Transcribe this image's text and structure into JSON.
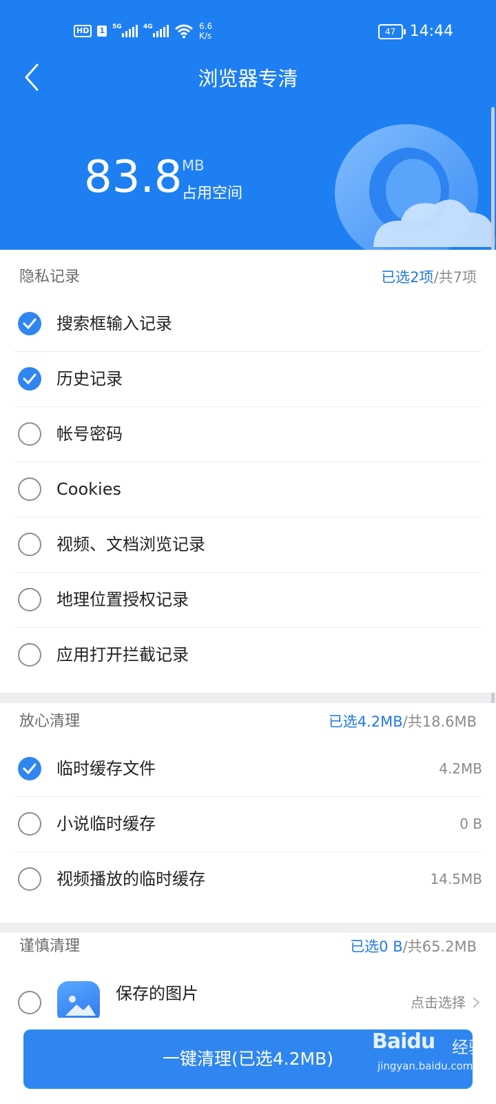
{
  "status_bar": {
    "hd_label": "HD",
    "sim_label": "1",
    "network1": "5G",
    "network2": "4G",
    "speed_value": "6.6",
    "speed_unit": "K/s",
    "battery": "47",
    "time": "14:44"
  },
  "header": {
    "title": "浏览器专清",
    "size_value": "83.8",
    "size_unit": "MB",
    "size_label": "占用空间"
  },
  "sections": {
    "privacy": {
      "title": "隐私记录",
      "selected": "已选2项",
      "total": "/共7项",
      "items": [
        {
          "label": "搜索框输入记录",
          "checked": true
        },
        {
          "label": "历史记录",
          "checked": true
        },
        {
          "label": "帐号密码",
          "checked": false
        },
        {
          "label": "Cookies",
          "checked": false
        },
        {
          "label": "视频、文档浏览记录",
          "checked": false
        },
        {
          "label": "地理位置授权记录",
          "checked": false
        },
        {
          "label": "应用打开拦截记录",
          "checked": false
        }
      ]
    },
    "safe": {
      "title": "放心清理",
      "selected": "已选4.2MB",
      "total": "/共18.6MB",
      "items": [
        {
          "label": "临时缓存文件",
          "size": "4.2MB",
          "checked": true
        },
        {
          "label": "小说临时缓存",
          "size": "0 B",
          "checked": false
        },
        {
          "label": "视频播放的临时缓存",
          "size": "14.5MB",
          "checked": false
        }
      ]
    },
    "careful": {
      "title": "谨慎清理",
      "selected": "已选0 B",
      "total": "/共65.2MB",
      "items": [
        {
          "label": "保存的图片",
          "action": "点击选择",
          "checked": false
        }
      ]
    }
  },
  "footer": {
    "clean_button": "一键清理(已选4.2MB)"
  },
  "watermark": {
    "brand": "Baidu",
    "brand_cn": "经验",
    "url": "jingyan.baidu.com"
  },
  "colors": {
    "header_blue": "#1e7ff2",
    "accent_blue": "#2f86f0",
    "selected_text": "#2079e6"
  }
}
